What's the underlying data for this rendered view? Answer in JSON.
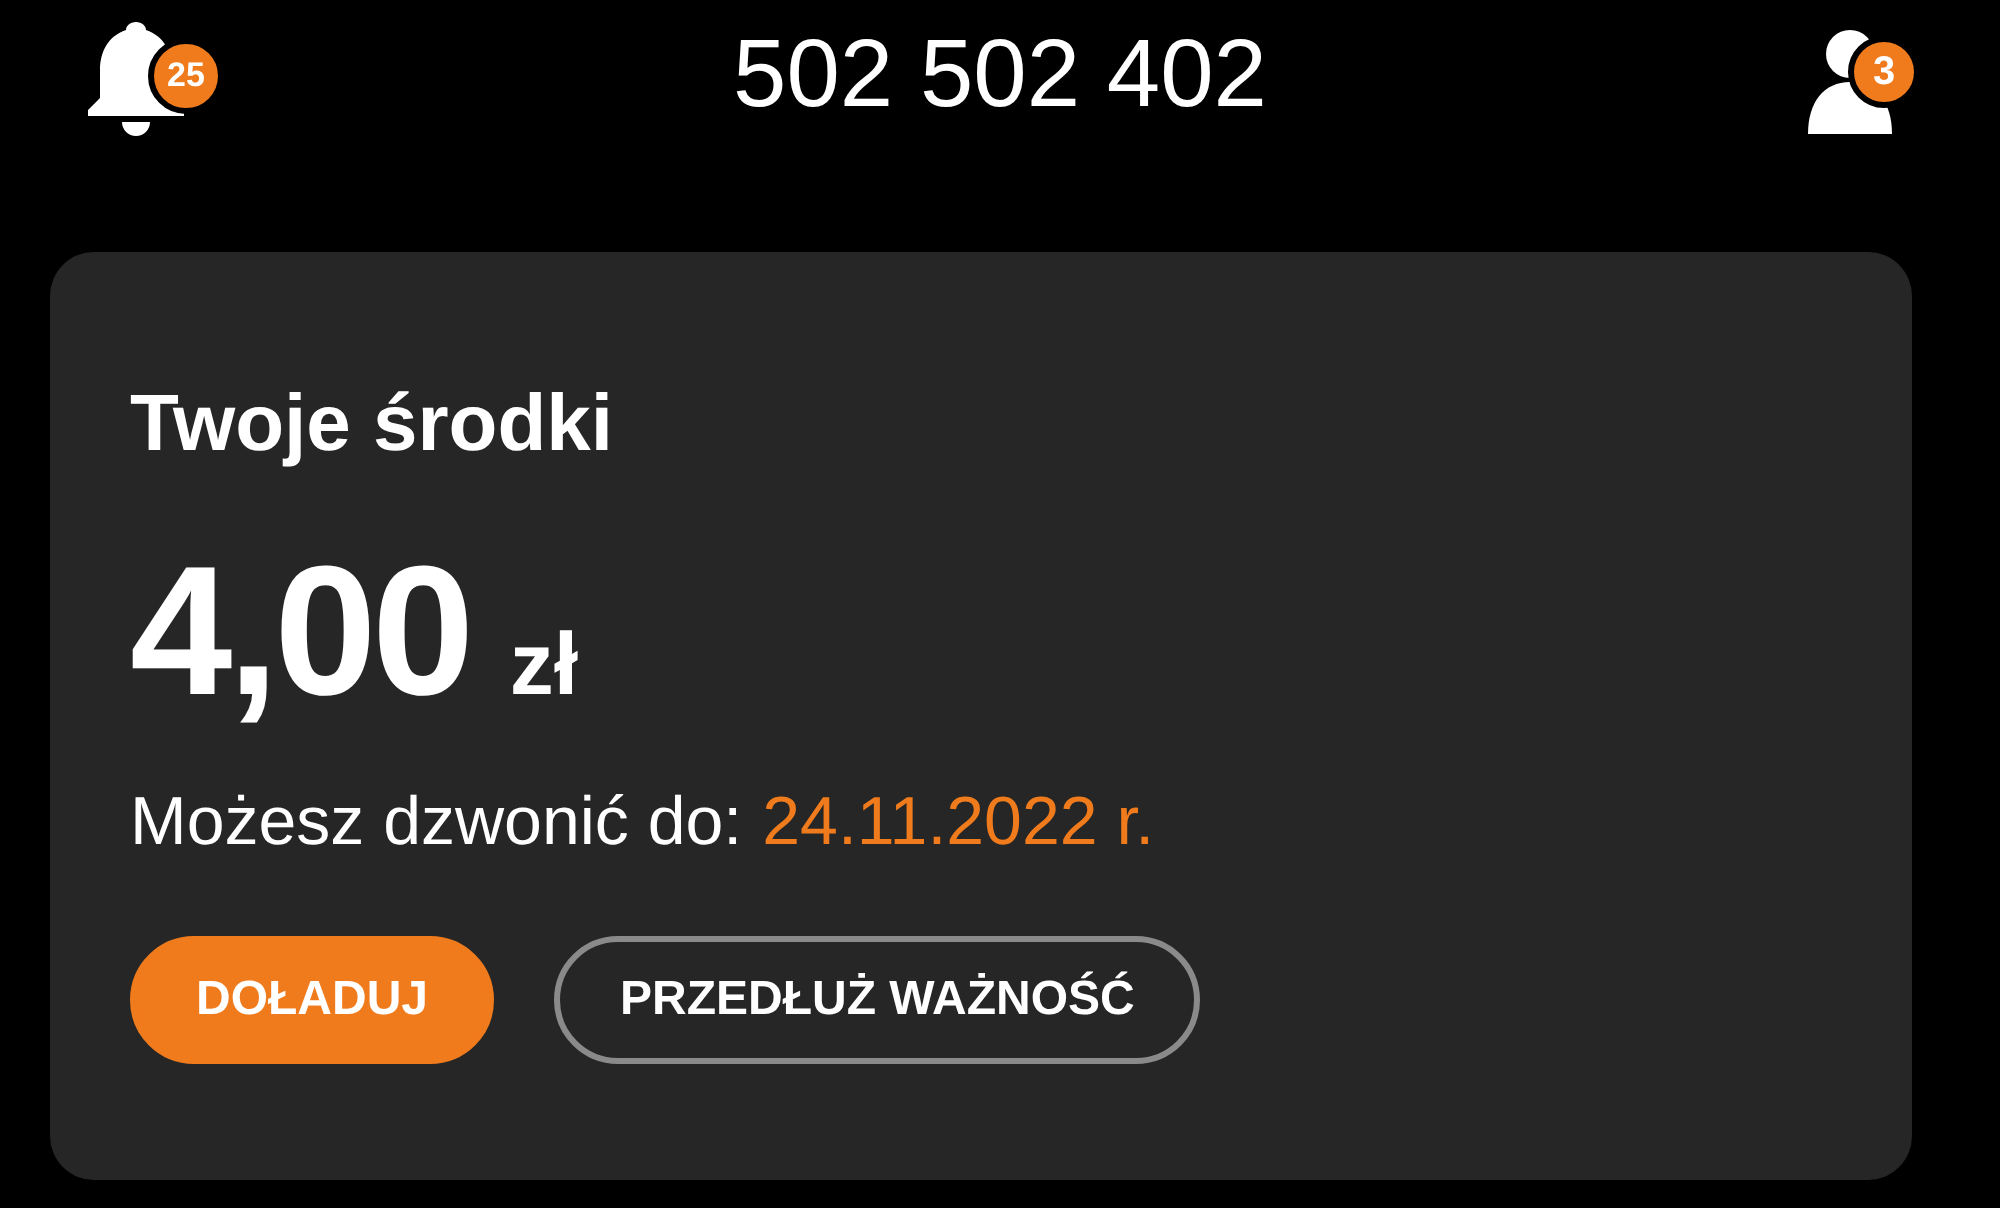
{
  "header": {
    "notifications_badge": "25",
    "phone_number": "502 502 402",
    "accounts_badge": "3"
  },
  "balance_card": {
    "title": "Twoje środki",
    "amount": "4,00",
    "currency": "zł",
    "validity_label": "Możesz dzwonić do:",
    "validity_date": "24.11.2022 r.",
    "buttons": [
      {
        "label": "DOŁADUJ",
        "kind": "primary"
      },
      {
        "label": "PRZEDŁUŻ WAŻNOŚĆ",
        "kind": "outline"
      }
    ]
  }
}
